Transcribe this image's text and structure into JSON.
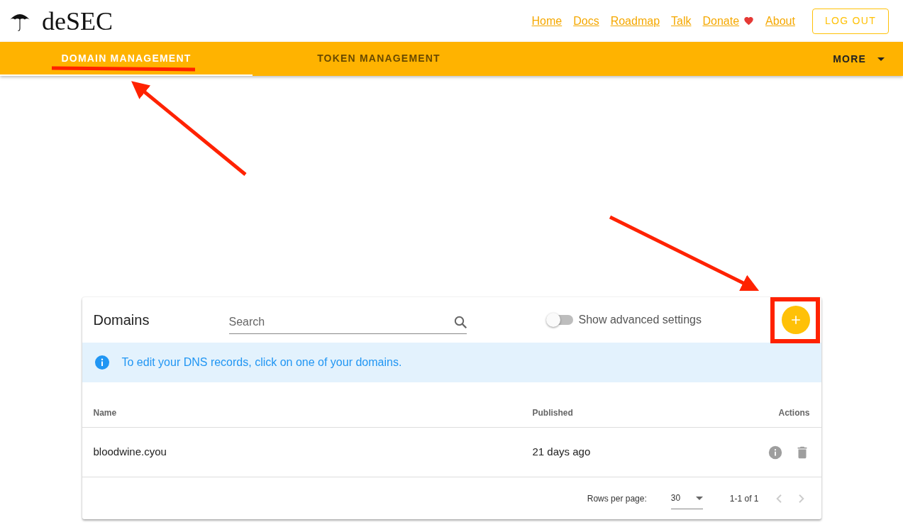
{
  "header": {
    "logo": "deSEC",
    "links": [
      {
        "label": "Home",
        "kind": "plain"
      },
      {
        "label": "Docs",
        "kind": "plain"
      },
      {
        "label": "Roadmap",
        "kind": "plain"
      },
      {
        "label": "Talk",
        "kind": "plain"
      },
      {
        "label": "Donate",
        "kind": "with-heart"
      },
      {
        "label": "About",
        "kind": "plain"
      }
    ],
    "logout_button": "LOG OUT"
  },
  "tabs": [
    {
      "label": "DOMAIN MANAGEMENT",
      "selected": true
    },
    {
      "label": "TOKEN MANAGEMENT",
      "selected": false
    }
  ],
  "more_menu": {
    "label": "MORE"
  },
  "domains_card": {
    "title": "Domains",
    "search": {
      "placeholder": "Search"
    },
    "advanced_toggle": {
      "label": "Show advanced settings",
      "on": false
    },
    "info": "To edit your DNS records, click on one of your domains.",
    "table": {
      "columns": [
        "Name",
        "Published",
        "Actions"
      ],
      "rows": [
        {
          "name": "bloodwine.cyou",
          "published": "21 days ago"
        }
      ]
    },
    "footer": {
      "rows_per_page_label": "Rows per page:",
      "rows_per_page": "30",
      "range": "1-1 of 1"
    }
  }
}
